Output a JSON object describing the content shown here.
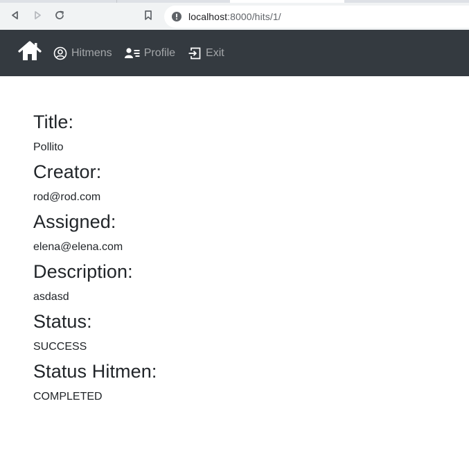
{
  "browser": {
    "url_host": "localhost",
    "url_path": ":8000/hits/1/",
    "icons": [
      "back-icon",
      "forward-icon",
      "reload-icon",
      "bookmark-icon",
      "site-info-icon"
    ]
  },
  "navbar": {
    "home_icon": "home-icon",
    "links": [
      {
        "label": "Hitmens",
        "icon": "user-circle-icon"
      },
      {
        "label": "Profile",
        "icon": "person-lines-icon"
      },
      {
        "label": "Exit",
        "icon": "exit-icon"
      }
    ],
    "colors": {
      "background": "#343a40",
      "link": "rgba(255,255,255,0.55)"
    }
  },
  "hit": {
    "fields": [
      {
        "label": "Title:",
        "value": "Pollito"
      },
      {
        "label": "Creator:",
        "value": "rod@rod.com"
      },
      {
        "label": "Assigned:",
        "value": "elena@elena.com"
      },
      {
        "label": "Description:",
        "value": "asdasd"
      },
      {
        "label": "Status:",
        "value": "SUCCESS"
      },
      {
        "label": "Status Hitmen:",
        "value": "COMPLETED"
      }
    ]
  }
}
